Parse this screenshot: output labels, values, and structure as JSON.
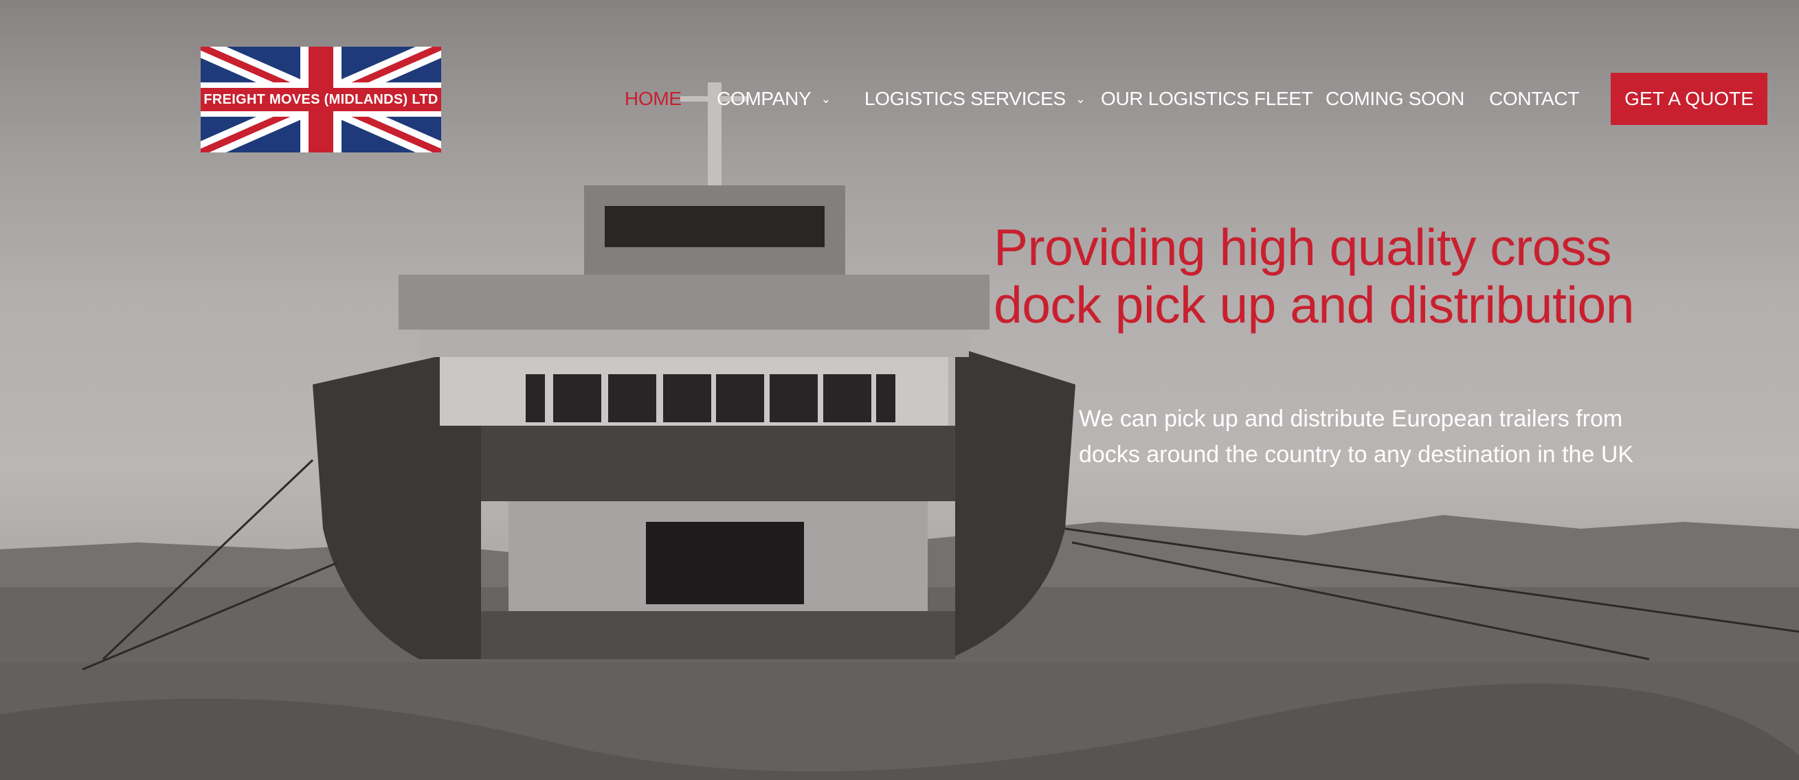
{
  "logo": {
    "text": "FREIGHT MOVES (MIDLANDS) LTD"
  },
  "nav": {
    "items": [
      {
        "label": "HOME",
        "active": true
      },
      {
        "label": "COMPANY",
        "has_dropdown": true
      },
      {
        "label": "LOGISTICS SERVICES",
        "has_dropdown": true
      },
      {
        "label": "OUR LOGISTICS FLEET"
      },
      {
        "label": "COMING SOON"
      },
      {
        "label": "CONTACT"
      }
    ],
    "cta_label": "GET A QUOTE"
  },
  "hero": {
    "headline": "Providing high quality cross dock pick up and distribution",
    "subtext": "We can pick up and distribute European trailers from docks around the country to any destination in the UK",
    "background_icon": "ferry-photo"
  },
  "colors": {
    "accent": "#c8202f",
    "flag_blue": "#1f3a7a",
    "text_light": "#ffffff"
  }
}
